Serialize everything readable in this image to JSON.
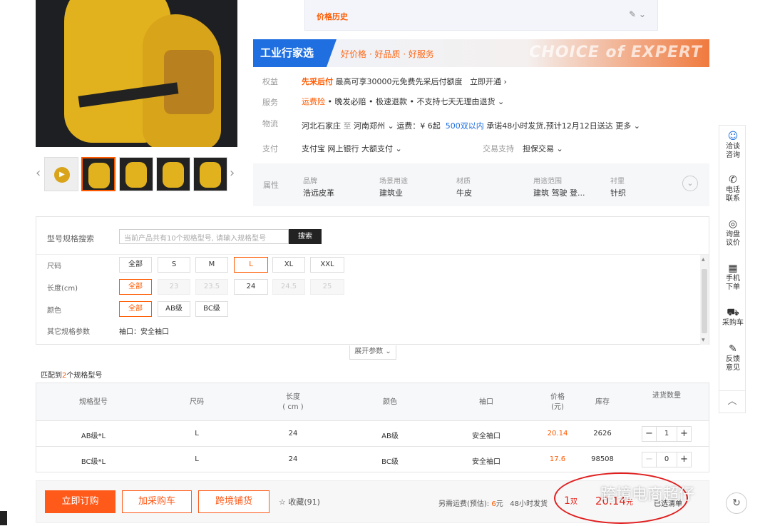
{
  "price_history": {
    "title": "价格历史",
    "icons": "✎ ⌄"
  },
  "banner": {
    "brand": "工业行家选",
    "slogan": "好价格 · 好品质 · 好服务",
    "english": "CHOICE of EXPERT"
  },
  "rights": {
    "label": "权益",
    "tag": "先采后付",
    "text": "最高可享30000元免费先采后付额度",
    "action": "立即开通 ›"
  },
  "service": {
    "label": "服务",
    "tag": "运费险",
    "text": "• 晚发必赔 • 极速退款 • 不支持七天无理由退货 ⌄"
  },
  "logistics": {
    "label": "物流",
    "from": "河北石家庄",
    "to_word": "至",
    "to": "河南郑州 ⌄",
    "fee": "运费：¥ 6起",
    "qty": "500双以内",
    "promise": "承诺48小时发货,预计12月12日送达",
    "more": "更多 ⌄"
  },
  "payment": {
    "label": "支付",
    "methods": "支付宝   网上银行   大额支付 ⌄",
    "trade_label": "交易支持",
    "trade": "担保交易 ⌄"
  },
  "attributes": {
    "label": "属性",
    "items": [
      {
        "k": "品牌",
        "v": "浩远皮革"
      },
      {
        "k": "场景用途",
        "v": "建筑业"
      },
      {
        "k": "材质",
        "v": "牛皮"
      },
      {
        "k": "用途范围",
        "v": "建筑 驾驶 登..."
      },
      {
        "k": "衬里",
        "v": "针织"
      }
    ],
    "expand": "⌄"
  },
  "spec": {
    "search_label": "型号规格搜索",
    "search_placeholder": "当前产品共有10个规格型号, 请输入规格型号",
    "search_button": "搜索",
    "size_label": "尺码",
    "sizes": [
      "全部",
      "S",
      "M",
      "L",
      "XL",
      "XXL"
    ],
    "length_label": "长度(cm)",
    "lengths": [
      "全部",
      "23",
      "23.5",
      "24",
      "24.5",
      "25"
    ],
    "color_label": "颜色",
    "colors": [
      "全部",
      "AB级",
      "BC级"
    ],
    "other_label": "其它规格参数",
    "other_value": "袖口：安全袖口",
    "expand": "展开参数 ⌄"
  },
  "match": {
    "prefix": "匹配到",
    "count": "2",
    "suffix": "个规格型号"
  },
  "table": {
    "headers": [
      "规格型号",
      "尺码",
      "长度\n( cm )",
      "颜色",
      "袖口",
      "价格\n(元)",
      "库存",
      "进货数量"
    ],
    "rows": [
      {
        "model": "AB级*L",
        "size": "L",
        "length": "24",
        "color": "AB级",
        "cuff": "安全袖口",
        "price": "20.14",
        "stock": "2626",
        "qty": "1"
      },
      {
        "model": "BC级*L",
        "size": "L",
        "length": "24",
        "color": "BC级",
        "cuff": "安全袖口",
        "price": "17.6",
        "stock": "98508",
        "qty": "0"
      }
    ]
  },
  "bottom": {
    "order": "立即订购",
    "cart": "加采购车",
    "cross": "跨境铺货",
    "fav": "☆ 收藏(91)",
    "ship_prefix": "另需运费(预估): ",
    "ship_fee": "6",
    "ship_unit": "元",
    "ship_time": "48小时发货",
    "qty": "1",
    "qty_unit": "双",
    "total": "20.14",
    "total_unit": "元",
    "list": "已选清单"
  },
  "watermark": "跨境电商超仔",
  "sidebar": [
    {
      "icon": "☺",
      "label": "洽谈咨询"
    },
    {
      "icon": "✆",
      "label": "电话联系"
    },
    {
      "icon": "◎",
      "label": "询盘议价"
    },
    {
      "icon": "▦",
      "label": "手机下单"
    },
    {
      "icon": "⛟",
      "label": "采购车"
    },
    {
      "icon": "✎",
      "label": "反馈意见"
    }
  ],
  "side_up": "︿",
  "colors": {
    "accent": "#ff5a00",
    "brand_blue": "#1f6fe0",
    "annotation": "#e01e1e"
  }
}
